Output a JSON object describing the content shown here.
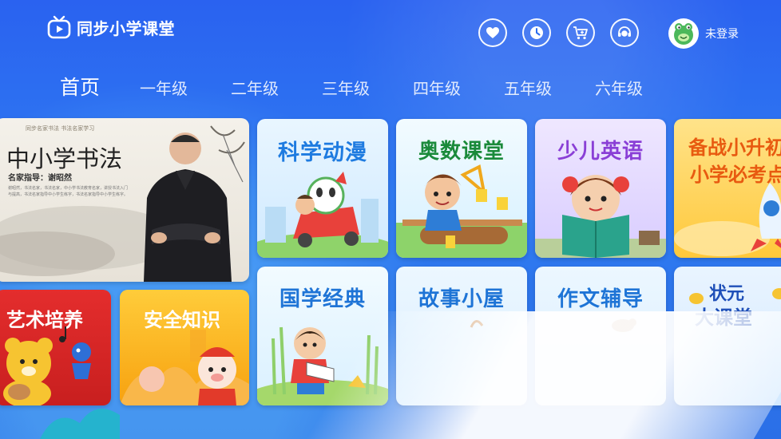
{
  "app": {
    "title": "同步小学课堂"
  },
  "header": {
    "actions": [
      {
        "name": "heart-icon",
        "label": "收藏"
      },
      {
        "name": "clock-icon",
        "label": "历史"
      },
      {
        "name": "cart-icon",
        "label": "购买"
      },
      {
        "name": "customer-service-icon",
        "label": "客服"
      }
    ],
    "user": {
      "status": "未登录"
    }
  },
  "nav": {
    "tabs": [
      "首页",
      "一年级",
      "二年级",
      "三年级",
      "四年级",
      "五年级",
      "六年级"
    ],
    "active_index": 0
  },
  "cards": {
    "hero": {
      "small": "同步名家书法  书法名家学习",
      "title": "中小学书法",
      "subtitle": "名家指导：谢昭然",
      "body": "谢昭然，书法名家，书法名家，中小学书法教育名家，讲授书法入门与提高，书法名家指导中小学生练字，书法名家指导中小学生练字。"
    },
    "sci": "科学动漫",
    "math": "奥数课堂",
    "eng": "少儿英语",
    "exam": {
      "line1": "备战小升初",
      "line2": "小学必考点"
    },
    "art": "艺术培养",
    "safe": "安全知识",
    "guo": "国学经典",
    "story": "故事小屋",
    "essay": "作文辅导",
    "zhuang": {
      "line1": "状元",
      "line2": "大课堂"
    }
  },
  "colors": {
    "bg_top": "#2a62f0",
    "text_blue": "#1f74d6",
    "art_red": "#e42d2d",
    "safe_orange": "#f7a10f"
  }
}
